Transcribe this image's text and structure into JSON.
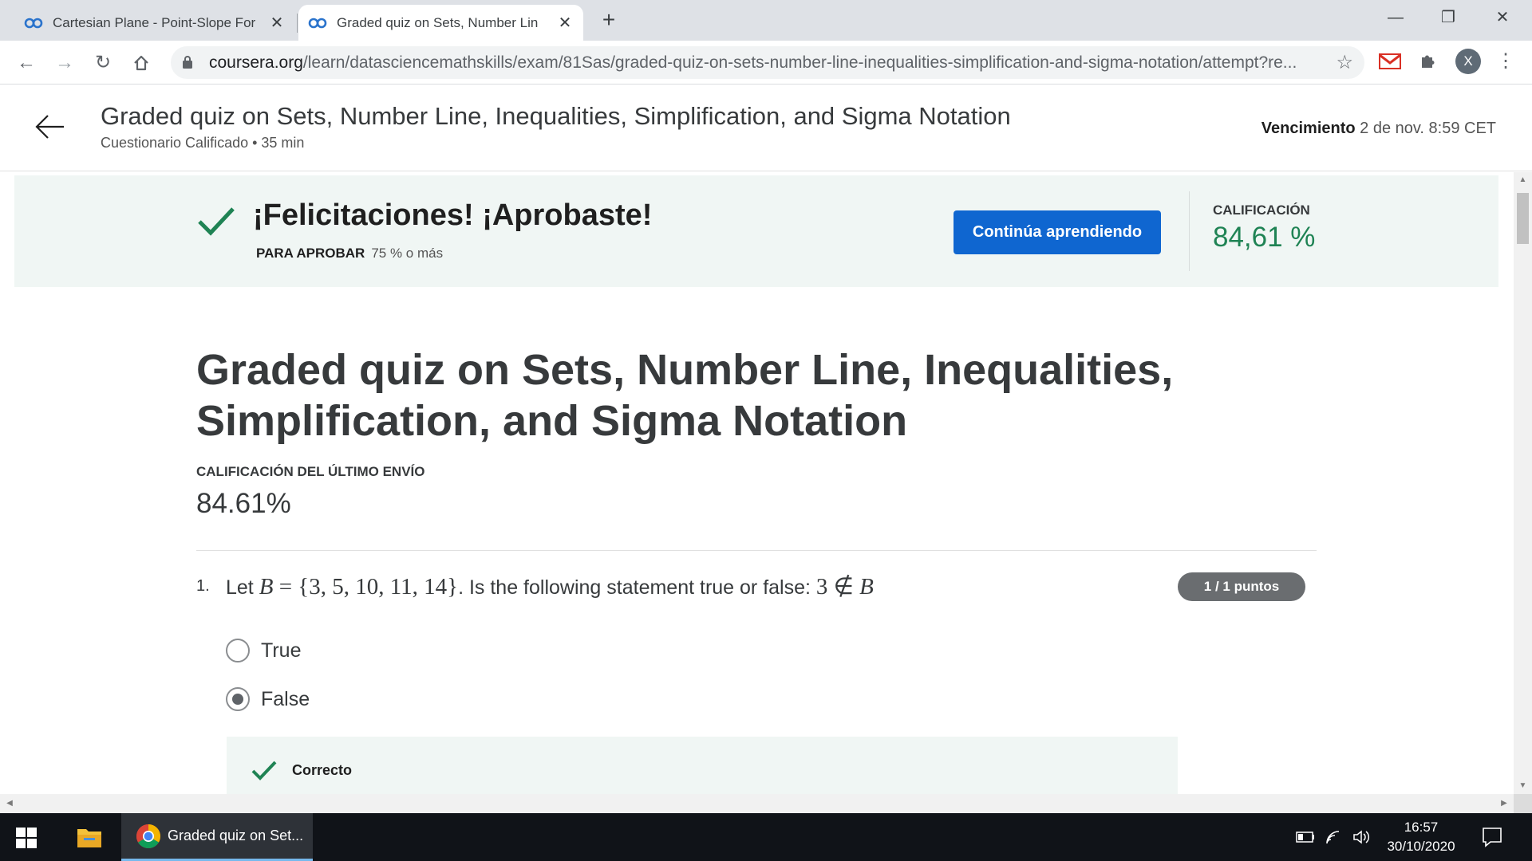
{
  "browser": {
    "tabs": [
      {
        "title": "Cartesian Plane - Point-Slope For",
        "active": false
      },
      {
        "title": "Graded quiz on Sets, Number Lin",
        "active": true
      }
    ],
    "url_host": "coursera.org",
    "url_path": "/learn/datasciencemathskills/exam/81Sas/graded-quiz-on-sets-number-line-inequalities-simplification-and-sigma-notation/attempt?re...",
    "avatar_initial": "X"
  },
  "header": {
    "title": "Graded quiz on Sets, Number Line, Inequalities, Simplification, and Sigma Notation",
    "subtitle": "Cuestionario Calificado • 35 min",
    "due_label": "Vencimiento",
    "due_value": "2 de nov. 8:59 CET"
  },
  "banner": {
    "congrats": "¡Felicitaciones! ¡Aprobaste!",
    "pass_label": "PARA APROBAR",
    "pass_value": "75 % o más",
    "continue_button": "Continúa aprendiendo",
    "grade_label": "CALIFICACIÓN",
    "grade_value": "84,61 %"
  },
  "quiz": {
    "title": "Graded quiz on Sets, Number Line, Inequalities, Simplification, and Sigma Notation",
    "last_submission_label": "CALIFICACIÓN DEL ÚLTIMO ENVÍO",
    "last_submission_value": "84.61%"
  },
  "question1": {
    "number": "1.",
    "text_prefix": "Let",
    "math_set_var": "B",
    "math_set": " = {3, 5, 10, 11, 14}",
    "text_mid": ". Is the following statement true or false:",
    "math_statement_num": "3",
    "math_statement_op": " ∉ ",
    "math_statement_var": "B",
    "points": "1 / 1 puntos",
    "options": [
      {
        "label": "True",
        "selected": false
      },
      {
        "label": "False",
        "selected": true
      }
    ],
    "feedback_label": "Correcto"
  },
  "taskbar": {
    "app_label": "Graded quiz on Set...",
    "time": "16:57",
    "date": "30/10/2020"
  },
  "colors": {
    "accent_blue": "#0f66d0",
    "success_green": "#1f8354",
    "banner_bg": "#f0f6f4"
  }
}
